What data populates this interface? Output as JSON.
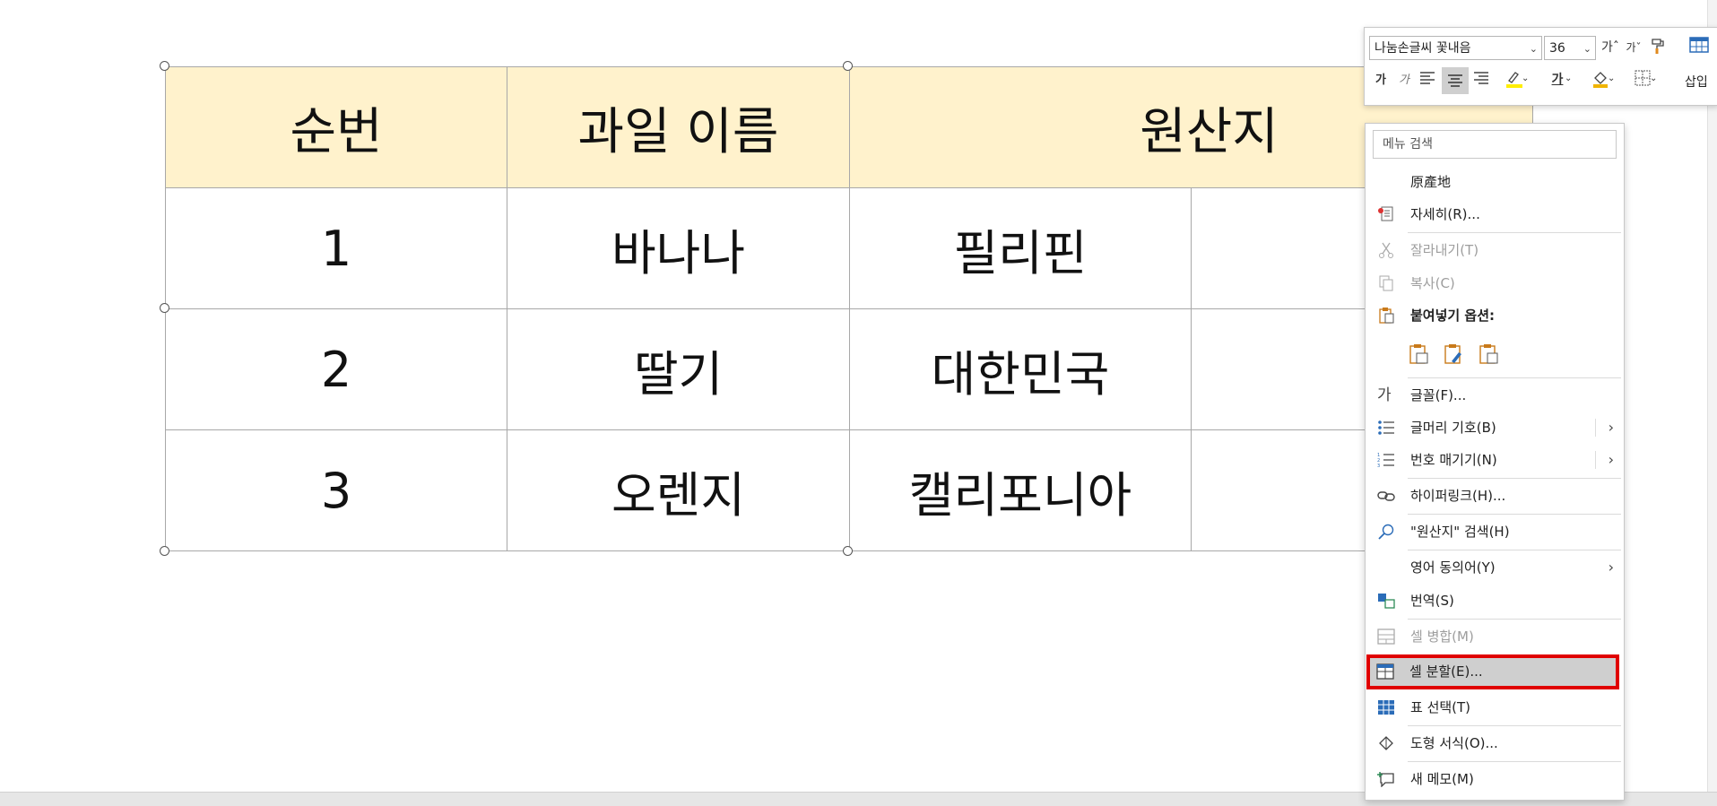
{
  "table": {
    "header": [
      "순번",
      "과일 이름",
      "원산지"
    ],
    "rows": [
      [
        "1",
        "바나나",
        "필리핀",
        ""
      ],
      [
        "2",
        "딸기",
        "대한민국",
        ""
      ],
      [
        "3",
        "오렌지",
        "캘리포니아",
        ""
      ]
    ],
    "header_bg": "#fff2cc"
  },
  "mini_toolbar": {
    "font_name": "나눔손글씨 꽃내음",
    "font_size": "36",
    "grow_font": "가ˆ",
    "shrink_font": "가ˇ",
    "bold": "가",
    "italic": "가",
    "font_color_glyph": "가",
    "insert_label": "삽입"
  },
  "context_menu": {
    "search_placeholder": "메뉴 검색",
    "items": [
      {
        "label": "原產地"
      },
      {
        "label": "자세히(R)..."
      },
      {
        "label": "잘라내기(T)"
      },
      {
        "label": "복사(C)"
      },
      {
        "label": "붙여넣기 옵션:"
      },
      {
        "label": "글꼴(F)..."
      },
      {
        "label": "글머리 기호(B)"
      },
      {
        "label": "번호 매기기(N)"
      },
      {
        "label": "하이퍼링크(H)..."
      },
      {
        "label": "\"원산지\" 검색(H)"
      },
      {
        "label": "영어 동의어(Y)"
      },
      {
        "label": "번역(S)"
      },
      {
        "label": "셀 병합(M)"
      },
      {
        "label": "셀 분할(E)..."
      },
      {
        "label": "표 선택(T)"
      },
      {
        "label": "도형 서식(O)..."
      },
      {
        "label": "새 메모(M)"
      }
    ],
    "font_icon_glyph": "가",
    "highlight_color": "#e00000"
  }
}
